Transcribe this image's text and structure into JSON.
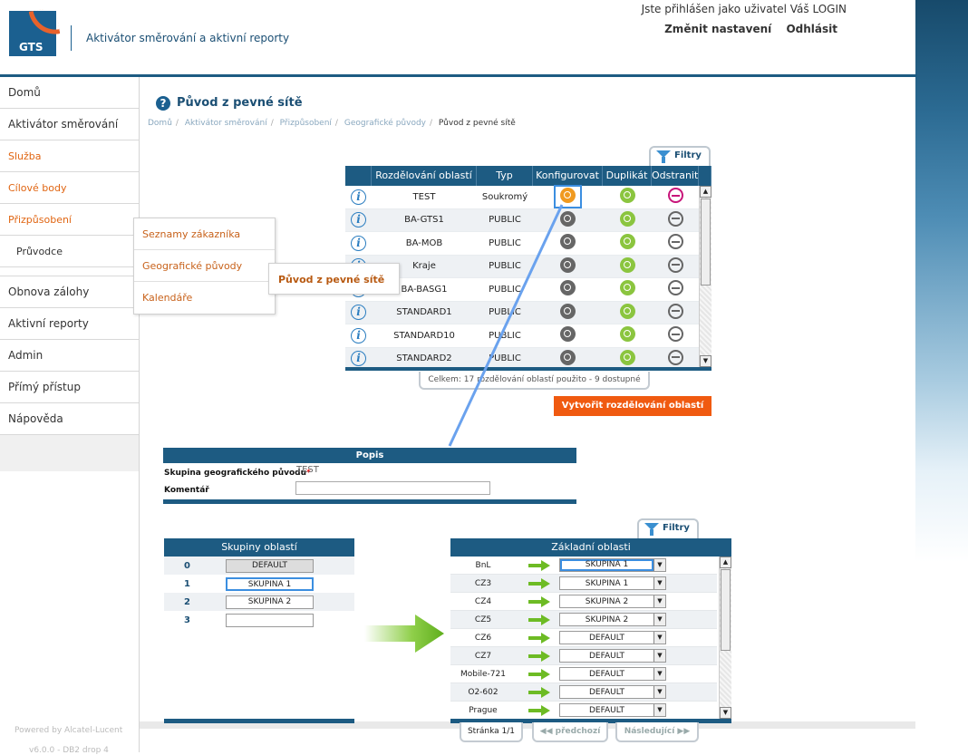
{
  "header": {
    "logo_text": "GTS",
    "app_title": "Aktivátor směrování a aktivní reporty",
    "login_info": "Jste přihlášen jako uživatel Váš LOGIN",
    "settings_link": "Změnit nastavení",
    "logout_link": "Odhlásit"
  },
  "sidebar": {
    "items": [
      {
        "label": "Domů"
      },
      {
        "label": "Aktivátor směrování"
      },
      {
        "label": "Služba"
      },
      {
        "label": "Cílové body"
      },
      {
        "label": "Přizpůsobení"
      },
      {
        "label": "Průvodce"
      },
      {
        "label": "Obnova zálohy"
      },
      {
        "label": "Aktivní reporty"
      },
      {
        "label": "Admin"
      },
      {
        "label": "Přímý přístup"
      },
      {
        "label": "Nápověda"
      }
    ],
    "powered": "Powered by Alcatel-Lucent",
    "version": "v6.0.0 - DB2 drop 4"
  },
  "flyout": {
    "items": [
      "Seznamy zákazníka",
      "Geografické původy",
      "Kalendáře"
    ],
    "submenu": "Původ z pevné sítě"
  },
  "page": {
    "title": "Původ z pevné sítě",
    "breadcrumb": [
      "Domů",
      "Aktivátor směrování",
      "Přizpůsobení",
      "Geografické původy",
      "Původ z pevné sítě"
    ]
  },
  "filters_label": "Filtry",
  "main_table": {
    "headers": [
      "Rozdělování oblastí",
      "Typ",
      "Konfigurovat",
      "Duplikát",
      "Odstranit"
    ],
    "rows": [
      {
        "name": "TEST",
        "type": "Soukromý"
      },
      {
        "name": "BA-GTS1",
        "type": "PUBLIC"
      },
      {
        "name": "BA-MOB",
        "type": "PUBLIC"
      },
      {
        "name": "Kraje",
        "type": "PUBLIC"
      },
      {
        "name": "BA-BASG1",
        "type": "PUBLIC"
      },
      {
        "name": "STANDARD1",
        "type": "PUBLIC"
      },
      {
        "name": "STANDARD10",
        "type": "PUBLIC"
      },
      {
        "name": "STANDARD2",
        "type": "PUBLIC"
      }
    ],
    "summary": "Celkem: 17 rozdělování oblastí použito  - 9 dostupné",
    "create_button": "Vytvořit rozdělování oblastí"
  },
  "popis": {
    "title": "Popis",
    "group_label": "Skupina geografického původu",
    "group_value": "TEST",
    "comment_label": "Komentář",
    "comment_value": ""
  },
  "groups": {
    "title": "Skupiny oblastí",
    "rows": [
      {
        "index": "0",
        "value": "DEFAULT"
      },
      {
        "index": "1",
        "value": "SKUPINA 1"
      },
      {
        "index": "2",
        "value": "SKUPINA 2"
      },
      {
        "index": "3",
        "value": ""
      }
    ]
  },
  "base_areas": {
    "title": "Základní oblasti",
    "rows": [
      {
        "name": "BnL",
        "group": "SKUPINA 1"
      },
      {
        "name": "CZ3",
        "group": "SKUPINA 1"
      },
      {
        "name": "CZ4",
        "group": "SKUPINA 2"
      },
      {
        "name": "CZ5",
        "group": "SKUPINA 2"
      },
      {
        "name": "CZ6",
        "group": "DEFAULT"
      },
      {
        "name": "CZ7",
        "group": "DEFAULT"
      },
      {
        "name": "Mobile-721",
        "group": "DEFAULT"
      },
      {
        "name": "O2-602",
        "group": "DEFAULT"
      },
      {
        "name": "Prague",
        "group": "DEFAULT"
      }
    ]
  },
  "pager": {
    "page": "Stránka 1/1",
    "prev": "předchozí",
    "next": "Následující"
  }
}
